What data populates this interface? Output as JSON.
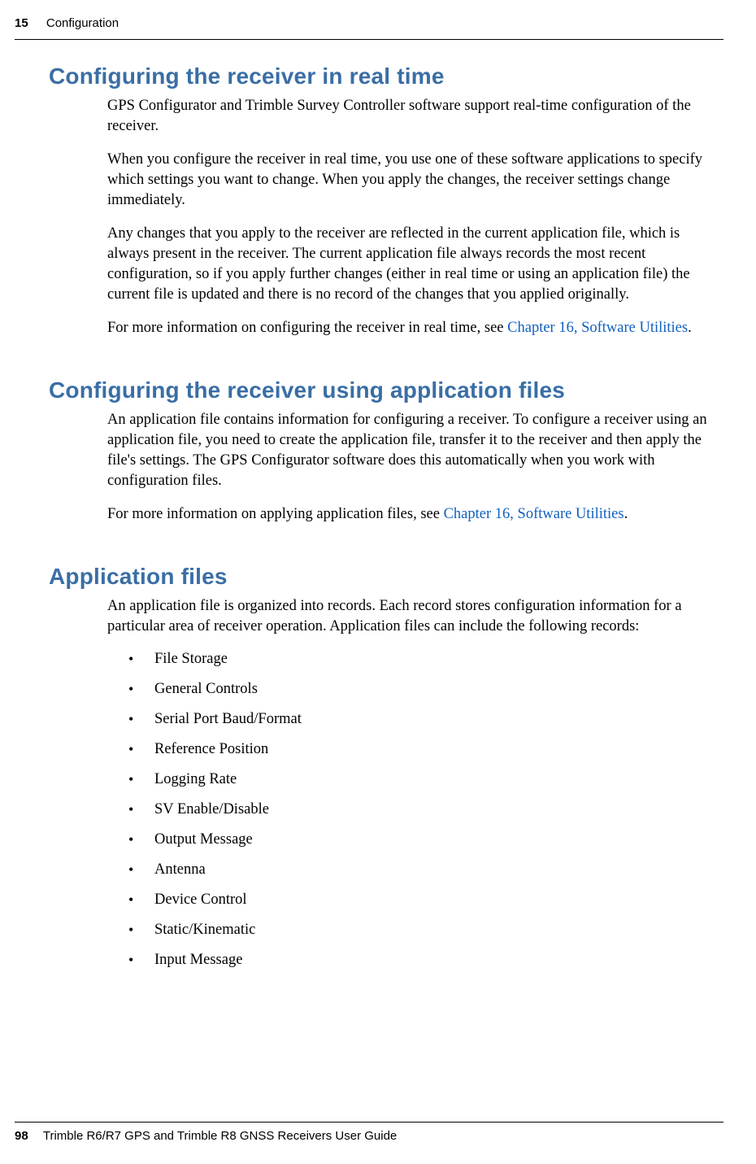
{
  "header": {
    "chapter_number": "15",
    "chapter_title": "Configuration"
  },
  "sections": {
    "s1": {
      "title": "Configuring the receiver in real time",
      "p1": "GPS Configurator and Trimble Survey Controller software support real-time configuration of the receiver.",
      "p2": "When you configure the receiver in real time, you use one of these software applications to specify which settings you want to change. When you apply the changes, the receiver settings change immediately.",
      "p3": "Any changes that you apply to the receiver are reflected in the current application file, which is always present in the receiver. The current application file always records the most recent configuration, so if you apply further changes (either in real time or using an application file) the current file is updated and there is no record of the changes that you applied originally.",
      "p4_a": "For more information on configuring the receiver in real time, see ",
      "p4_link": "Chapter 16, Software Utilities",
      "p4_b": "."
    },
    "s2": {
      "title": "Configuring the receiver using application files",
      "p1": "An application file contains information for configuring a receiver. To configure a receiver using an application file, you need to create the application file, transfer it to the receiver and then apply the file's settings. The GPS Configurator software does this automatically when you work with configuration files.",
      "p2_a": "For more information on applying application files, see ",
      "p2_link": "Chapter 16, Software Utilities",
      "p2_b": "."
    },
    "s3": {
      "title": "Application files",
      "p1": "An application file is organized into records. Each record stores configuration information for a particular area of receiver operation. Application files can include the following records:",
      "records": [
        "File Storage",
        "General Controls",
        "Serial Port Baud/Format",
        "Reference Position",
        "Logging Rate",
        "SV Enable/Disable",
        "Output Message",
        "Antenna",
        "Device Control",
        "Static/Kinematic",
        "Input Message"
      ]
    }
  },
  "footer": {
    "page_number": "98",
    "doc_title": "Trimble R6/R7 GPS and Trimble R8 GNSS Receivers User Guide"
  }
}
